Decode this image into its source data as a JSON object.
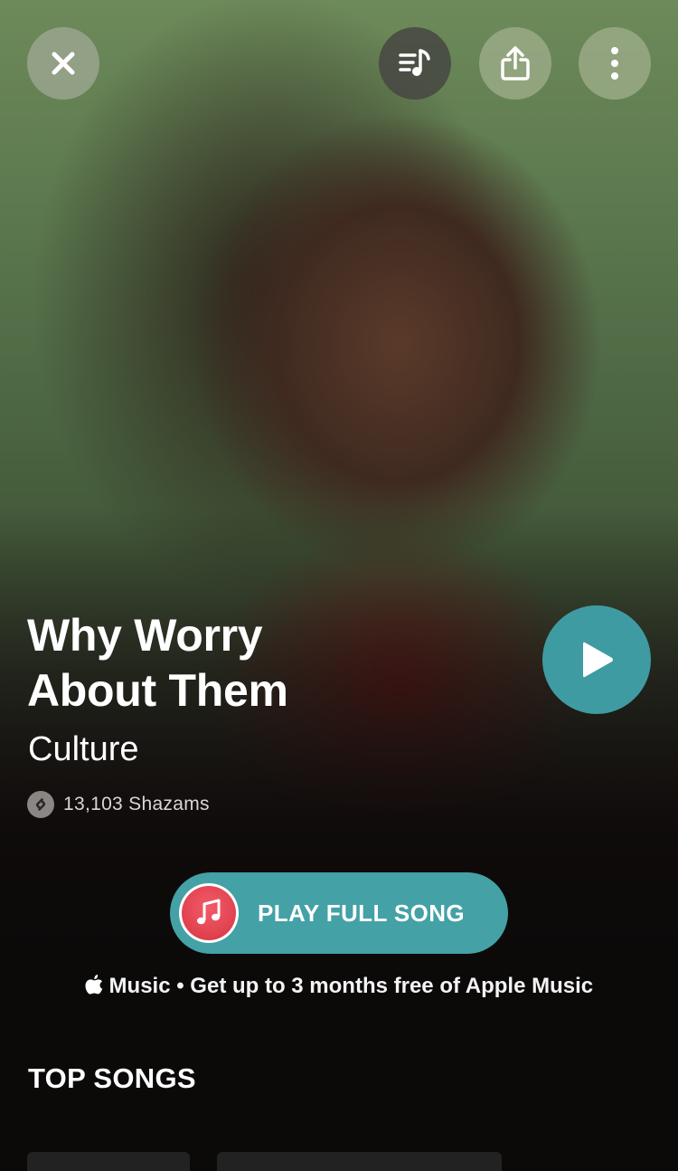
{
  "top_bar": {
    "close_icon": "close-icon",
    "queue_icon": "music-queue-icon",
    "share_icon": "share-icon",
    "more_icon": "more-vertical-icon"
  },
  "song": {
    "title_line1": "Why Worry",
    "title_line2": "About Them",
    "artist": "Culture",
    "shazam_count": "13,103 Shazams"
  },
  "actions": {
    "full_song_label": "PLAY FULL SONG"
  },
  "promo": {
    "apple_logo": "",
    "brand": "Music",
    "text": " • Get up to 3 months free of Apple Music"
  },
  "sections": {
    "top_songs_title": "TOP SONGS"
  },
  "colors": {
    "accent_teal": "#44a1a6",
    "apple_music_red": "#e0404e",
    "background": "#0d0a0a"
  }
}
